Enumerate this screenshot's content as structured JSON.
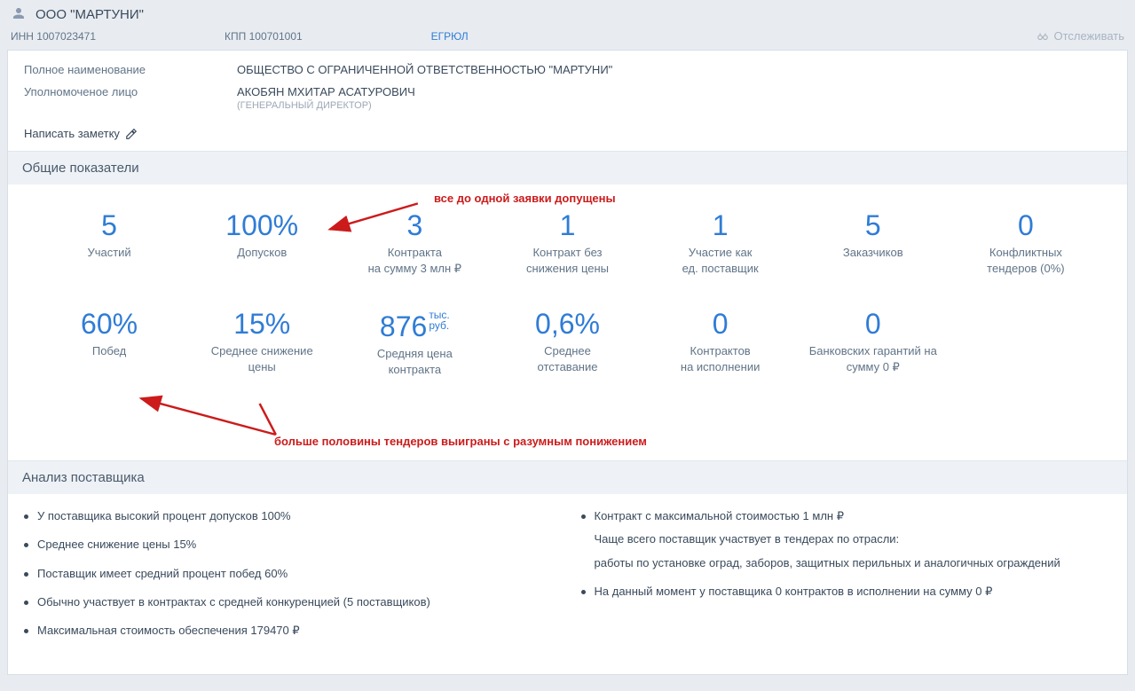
{
  "header": {
    "company_name": "ООО \"МАРТУНИ\"",
    "inn_label": "ИНН 1007023471",
    "kpp_label": "КПП 100701001",
    "registry_link": "ЕГРЮЛ",
    "track_label": "Отслеживать"
  },
  "company": {
    "full_name_label": "Полное наименование",
    "full_name_value": "ОБЩЕСТВО С ОГРАНИЧЕННОЙ ОТВЕТСТВЕННОСТЬЮ \"МАРТУНИ\"",
    "authorized_label": "Уполномоченое лицо",
    "authorized_value": "АКОБЯН МХИТАР АСАТУРОВИЧ",
    "authorized_role": "(ГЕНЕРАЛЬНЫЙ ДИРЕКТОР)",
    "write_note": "Написать заметку"
  },
  "stats_header": "Общие показатели",
  "stats_row1": [
    {
      "value": "5",
      "unit": "",
      "label": "Участий"
    },
    {
      "value": "100%",
      "unit": "",
      "label": "Допусков"
    },
    {
      "value": "3",
      "unit": "",
      "label": "Контракта\nна сумму 3 млн ₽"
    },
    {
      "value": "1",
      "unit": "",
      "label": "Контракт без\nснижения цены"
    },
    {
      "value": "1",
      "unit": "",
      "label": "Участие как\nед. поставщик"
    },
    {
      "value": "5",
      "unit": "",
      "label": "Заказчиков"
    },
    {
      "value": "0",
      "unit": "",
      "label": "Конфликтных\nтендеров (0%)"
    }
  ],
  "stats_row2": [
    {
      "value": "60%",
      "unit": "",
      "label": "Побед"
    },
    {
      "value": "15%",
      "unit": "",
      "label": "Среднее снижение\nцены"
    },
    {
      "value": "876",
      "unit": "тыс.\nруб.",
      "label": "Средняя цена\nконтракта"
    },
    {
      "value": "0,6%",
      "unit": "",
      "label": "Среднее\nотставание"
    },
    {
      "value": "0",
      "unit": "",
      "label": "Контрактов\nна исполнении"
    },
    {
      "value": "0",
      "unit": "",
      "label": "Банковских гарантий на\nсумму 0 ₽"
    }
  ],
  "annotations": {
    "top": "все до одной заявки допущены",
    "bottom": "больше половины тендеров выиграны с разумным понижением"
  },
  "analysis_header": "Анализ поставщика",
  "analysis_left": [
    "У поставщика высокий процент допусков 100%",
    "Среднее снижение цены 15%",
    "Поставщик имеет средний процент побед 60%",
    "Обычно участвует в контрактах с средней конкуренцией (5 поставщиков)",
    "Максимальная стоимость обеспечения 179470 ₽"
  ],
  "analysis_right": [
    "Контракт с максимальной стоимостью 1 млн ₽",
    "На данный момент у поставщика 0 контрактов в исполнении на сумму 0 ₽"
  ],
  "analysis_right_sub_intro": "Чаще всего поставщик участвует в тендерах по отрасли:",
  "analysis_right_sub_detail": "работы по установке оград, заборов, защитных перильных и аналогичных ограждений"
}
